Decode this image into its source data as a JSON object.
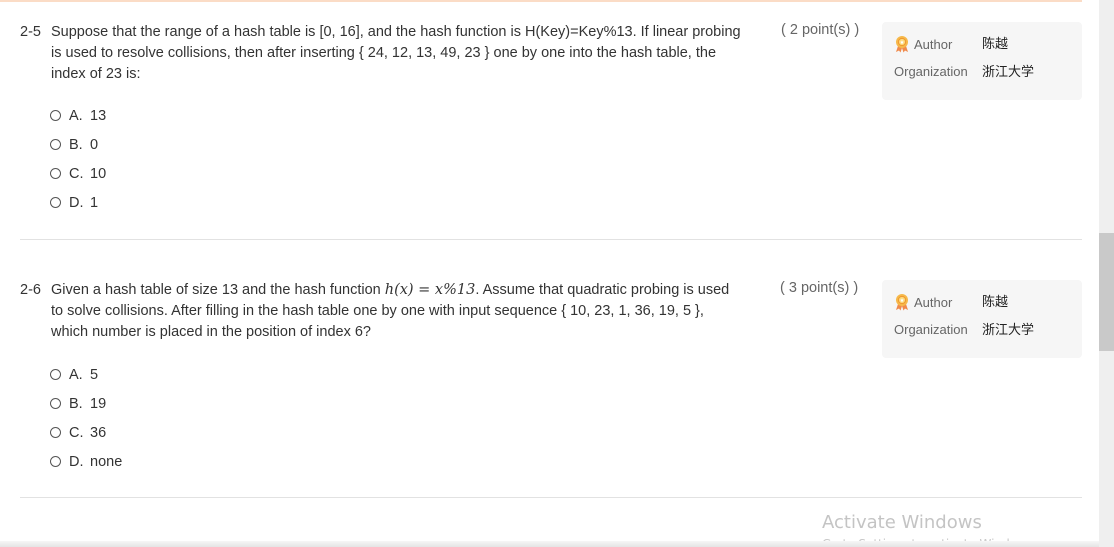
{
  "questions": [
    {
      "number": "2-5",
      "text_lines": [
        "Suppose that the range of a hash table is [0, 16], and the hash function is H(Key)=Key%13. If linear probing",
        "is used to resolve collisions, then after inserting { 24, 12, 13, 49, 23 } one by one into the hash table, the",
        "index of 23 is:"
      ],
      "score": "( 2 point(s) )",
      "author_label": "Author",
      "author_value": "陈越",
      "organization_label": "Organization",
      "organization_value": "浙江大学",
      "options": [
        {
          "letter": "A.",
          "value": "13"
        },
        {
          "letter": "B.",
          "value": "0"
        },
        {
          "letter": "C.",
          "value": "10"
        },
        {
          "letter": "D.",
          "value": "1"
        }
      ]
    },
    {
      "number": "2-6",
      "text_line1_before": "Given a hash table of size 13 and the hash function ",
      "math_h": "h(x) = x%13",
      "text_line1_after": ". Assume that quadratic probing is used",
      "text_lines": [
        "to solve collisions. After filling in the hash table one by one with input sequence { 10, 23, 1, 36, 19, 5 },",
        "which number is placed in the position of index 6?"
      ],
      "score": "( 3 point(s) )",
      "author_label": "Author",
      "author_value": "陈越",
      "organization_label": "Organization",
      "organization_value": "浙江大学",
      "options": [
        {
          "letter": "A.",
          "value": "5"
        },
        {
          "letter": "B.",
          "value": "19"
        },
        {
          "letter": "C.",
          "value": "36"
        },
        {
          "letter": "D.",
          "value": "none"
        }
      ]
    }
  ],
  "watermark": {
    "title": "Activate Windows",
    "subtitle": "Go to Settings to activate Windows."
  }
}
